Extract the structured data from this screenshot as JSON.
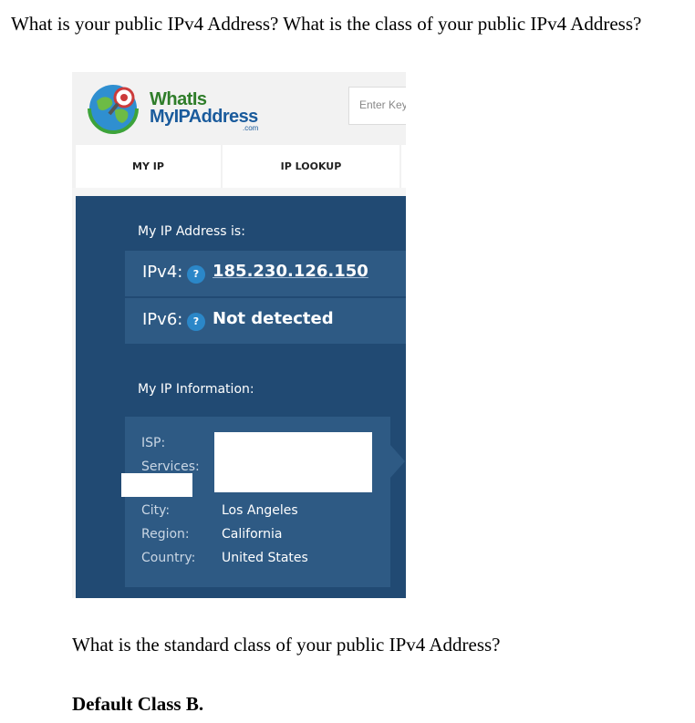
{
  "document": {
    "question_1": "What is your public IPv4 Address? What is the class of your public IPv4 Address?",
    "question_2": "What is the standard class of your public IPv4 Address?",
    "answer": "Default Class B."
  },
  "site": {
    "logo_line_1": "WhatIs",
    "logo_line_2": "MyIPAddress",
    "logo_suffix": ".com",
    "search_placeholder": "Enter Key",
    "tabs": [
      {
        "label": "MY IP"
      },
      {
        "label": "IP LOOKUP"
      }
    ],
    "my_ip_heading": "My IP Address is:",
    "ipv4": {
      "key": "IPv4:",
      "help": "?",
      "value": "185.230.126.150"
    },
    "ipv6": {
      "key": "IPv6:",
      "help": "?",
      "value": "Not detected"
    },
    "info_heading": "My IP Information:",
    "info": {
      "isp_label": "ISP:",
      "services_label": "Services:",
      "city_label": "City:",
      "city_value": "Los Angeles",
      "region_label": "Region:",
      "region_value": "California",
      "country_label": "Country:",
      "country_value": "United States"
    }
  },
  "colors": {
    "panel": "#214a73",
    "row": "#2e5a84",
    "help_badge": "#2b87c8",
    "logo_green": "#2f7d2a",
    "logo_blue": "#1a5b9c"
  }
}
